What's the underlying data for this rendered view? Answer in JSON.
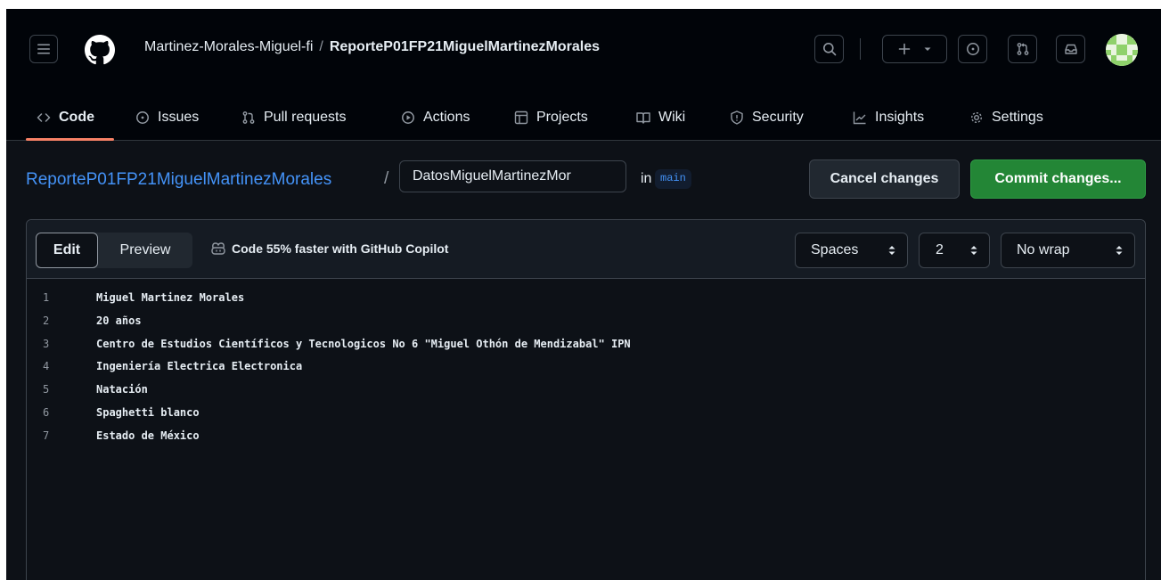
{
  "header": {
    "owner": "Martinez-Morales-Miguel-fi",
    "separator": "/",
    "repo": "ReporteP01FP21MiguelMartinezMorales",
    "icons": [
      "hamburger-icon",
      "github-logo-icon",
      "search-icon",
      "plus-icon",
      "issue-icon",
      "pull-request-icon",
      "inbox-icon"
    ]
  },
  "tabs": [
    {
      "label": "Code",
      "icon": "code-icon",
      "active": true
    },
    {
      "label": "Issues",
      "icon": "issue-icon"
    },
    {
      "label": "Pull requests",
      "icon": "pull-request-icon"
    },
    {
      "label": "Actions",
      "icon": "play-icon"
    },
    {
      "label": "Projects",
      "icon": "table-icon"
    },
    {
      "label": "Wiki",
      "icon": "book-icon"
    },
    {
      "label": "Security",
      "icon": "shield-icon"
    },
    {
      "label": "Insights",
      "icon": "graph-icon"
    },
    {
      "label": "Settings",
      "icon": "gear-icon"
    }
  ],
  "editor_bar": {
    "repo_link": "ReporteP01FP21MiguelMartinezMorales",
    "slash": "/",
    "filename": "DatosMiguelMartinezMor",
    "in_label": "in",
    "branch": "main",
    "cancel_label": "Cancel changes",
    "commit_label": "Commit changes..."
  },
  "editor": {
    "edit_tab": "Edit",
    "preview_tab": "Preview",
    "copilot_text": "Code 55% faster with GitHub Copilot",
    "indent_mode": "Spaces",
    "indent_size": "2",
    "wrap_mode": "No wrap",
    "lines": [
      {
        "n": "1",
        "text": "Miguel Martinez Morales"
      },
      {
        "n": "2",
        "text": "20 años"
      },
      {
        "n": "3",
        "text": "Centro de Estudios Científicos y Tecnologicos No 6 \"Miguel Othón de Mendizabal\" IPN"
      },
      {
        "n": "4",
        "text": "Ingeniería Electrica Electronica"
      },
      {
        "n": "5",
        "text": "Natación"
      },
      {
        "n": "6",
        "text": "Spaghetti blanco"
      },
      {
        "n": "7",
        "text": "Estado de México"
      }
    ]
  },
  "colors": {
    "accent_link": "#4493f8",
    "commit_green": "#238636",
    "tab_underline": "#f78166",
    "background": "#0d1117"
  }
}
